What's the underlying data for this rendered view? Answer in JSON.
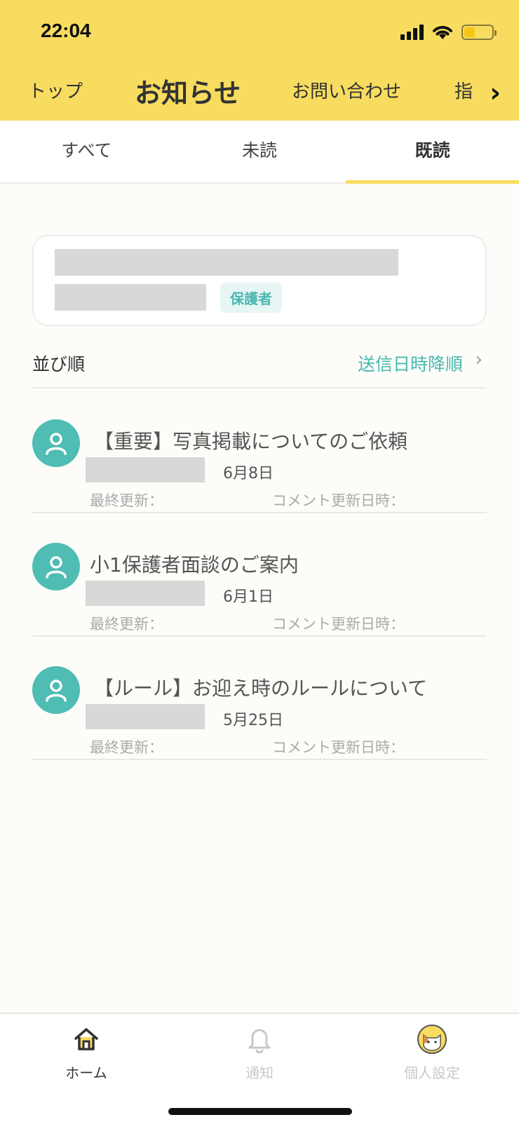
{
  "status_bar": {
    "time": "22:04"
  },
  "nav": {
    "items": [
      "トップ",
      "お知らせ",
      "お問い合わせ",
      "指"
    ],
    "active_index": 1
  },
  "tabs": [
    {
      "label": "すべて"
    },
    {
      "label": "未読"
    },
    {
      "label": "既読"
    }
  ],
  "selected_tab": "既読",
  "profile": {
    "role_badge": "保護者"
  },
  "sort": {
    "label": "並び順",
    "value": "送信日時降順"
  },
  "notices": [
    {
      "title": "【重要】写真掲載についてのご依頼",
      "date": "6月8日",
      "last_updated_label": "最終更新：",
      "comment_updated_label": "コメント更新日時："
    },
    {
      "title": "小1保護者面談のご案内",
      "date": "6月1日",
      "last_updated_label": "最終更新：",
      "comment_updated_label": "コメント更新日時："
    },
    {
      "title": "【ルール】お迎え時のルールについて",
      "date": "5月25日",
      "last_updated_label": "最終更新：",
      "comment_updated_label": "コメント更新日時："
    }
  ],
  "bottom_tabs": [
    {
      "label": "ホーム",
      "icon": "home-icon",
      "active": true
    },
    {
      "label": "通知",
      "icon": "bell-icon",
      "active": false
    },
    {
      "label": "個人設定",
      "icon": "cat-avatar-icon",
      "active": false
    }
  ],
  "colors": {
    "accent_yellow": "#f7dc5f",
    "teal": "#4fbdb3",
    "muted": "#aaaaaa"
  }
}
